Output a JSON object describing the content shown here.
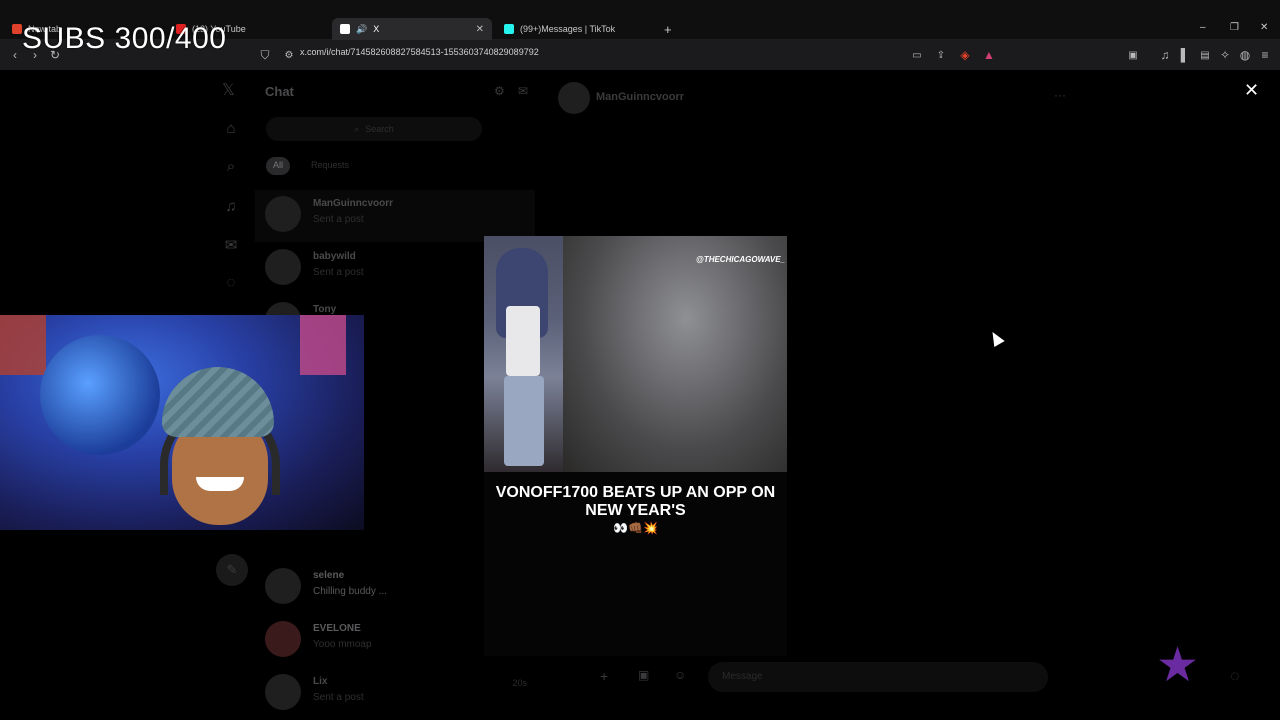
{
  "browser": {
    "tabs": [
      {
        "label": "New tab",
        "active": false
      },
      {
        "label": "(13) YouTube",
        "active": false
      },
      {
        "label": "X",
        "active": true
      },
      {
        "label": "(99+)Messages | TikTok",
        "active": false
      }
    ],
    "url": "x.com/i/chat/714582608827584513-1553603740829089792"
  },
  "overlay": {
    "subs_counter": "SUBS 300/400"
  },
  "x_page": {
    "chat_title": "Chat",
    "search_placeholder": "Search",
    "filters": [
      "All",
      "Requests"
    ],
    "conversations": [
      {
        "name": "ManGuinncvoorr",
        "message": "Sent a post",
        "time": ""
      },
      {
        "name": "babywild",
        "message": "Sent a post",
        "time": ""
      },
      {
        "name": "Tony",
        "message": "",
        "time": ""
      },
      {
        "name": "selene",
        "message": "Chilling buddy ...",
        "time": ""
      },
      {
        "name": "EVELONE",
        "message": "Yooo mmoap",
        "time": ""
      },
      {
        "name": "Lix",
        "message": "Sent a post",
        "time": "20s"
      }
    ],
    "open_chat_name": "ManGuinncvoorr",
    "composer_placeholder": "Message"
  },
  "media_viewer": {
    "watermark": "@THECHICAGOWAVE_",
    "caption": "VONOFF1700 BEATS UP AN OPP ON NEW YEAR'S",
    "caption_emojis": "👀👊🏾💥"
  },
  "icons": {
    "close": "close-icon",
    "back": "back-icon",
    "forward": "forward-icon",
    "reload": "reload-icon"
  }
}
